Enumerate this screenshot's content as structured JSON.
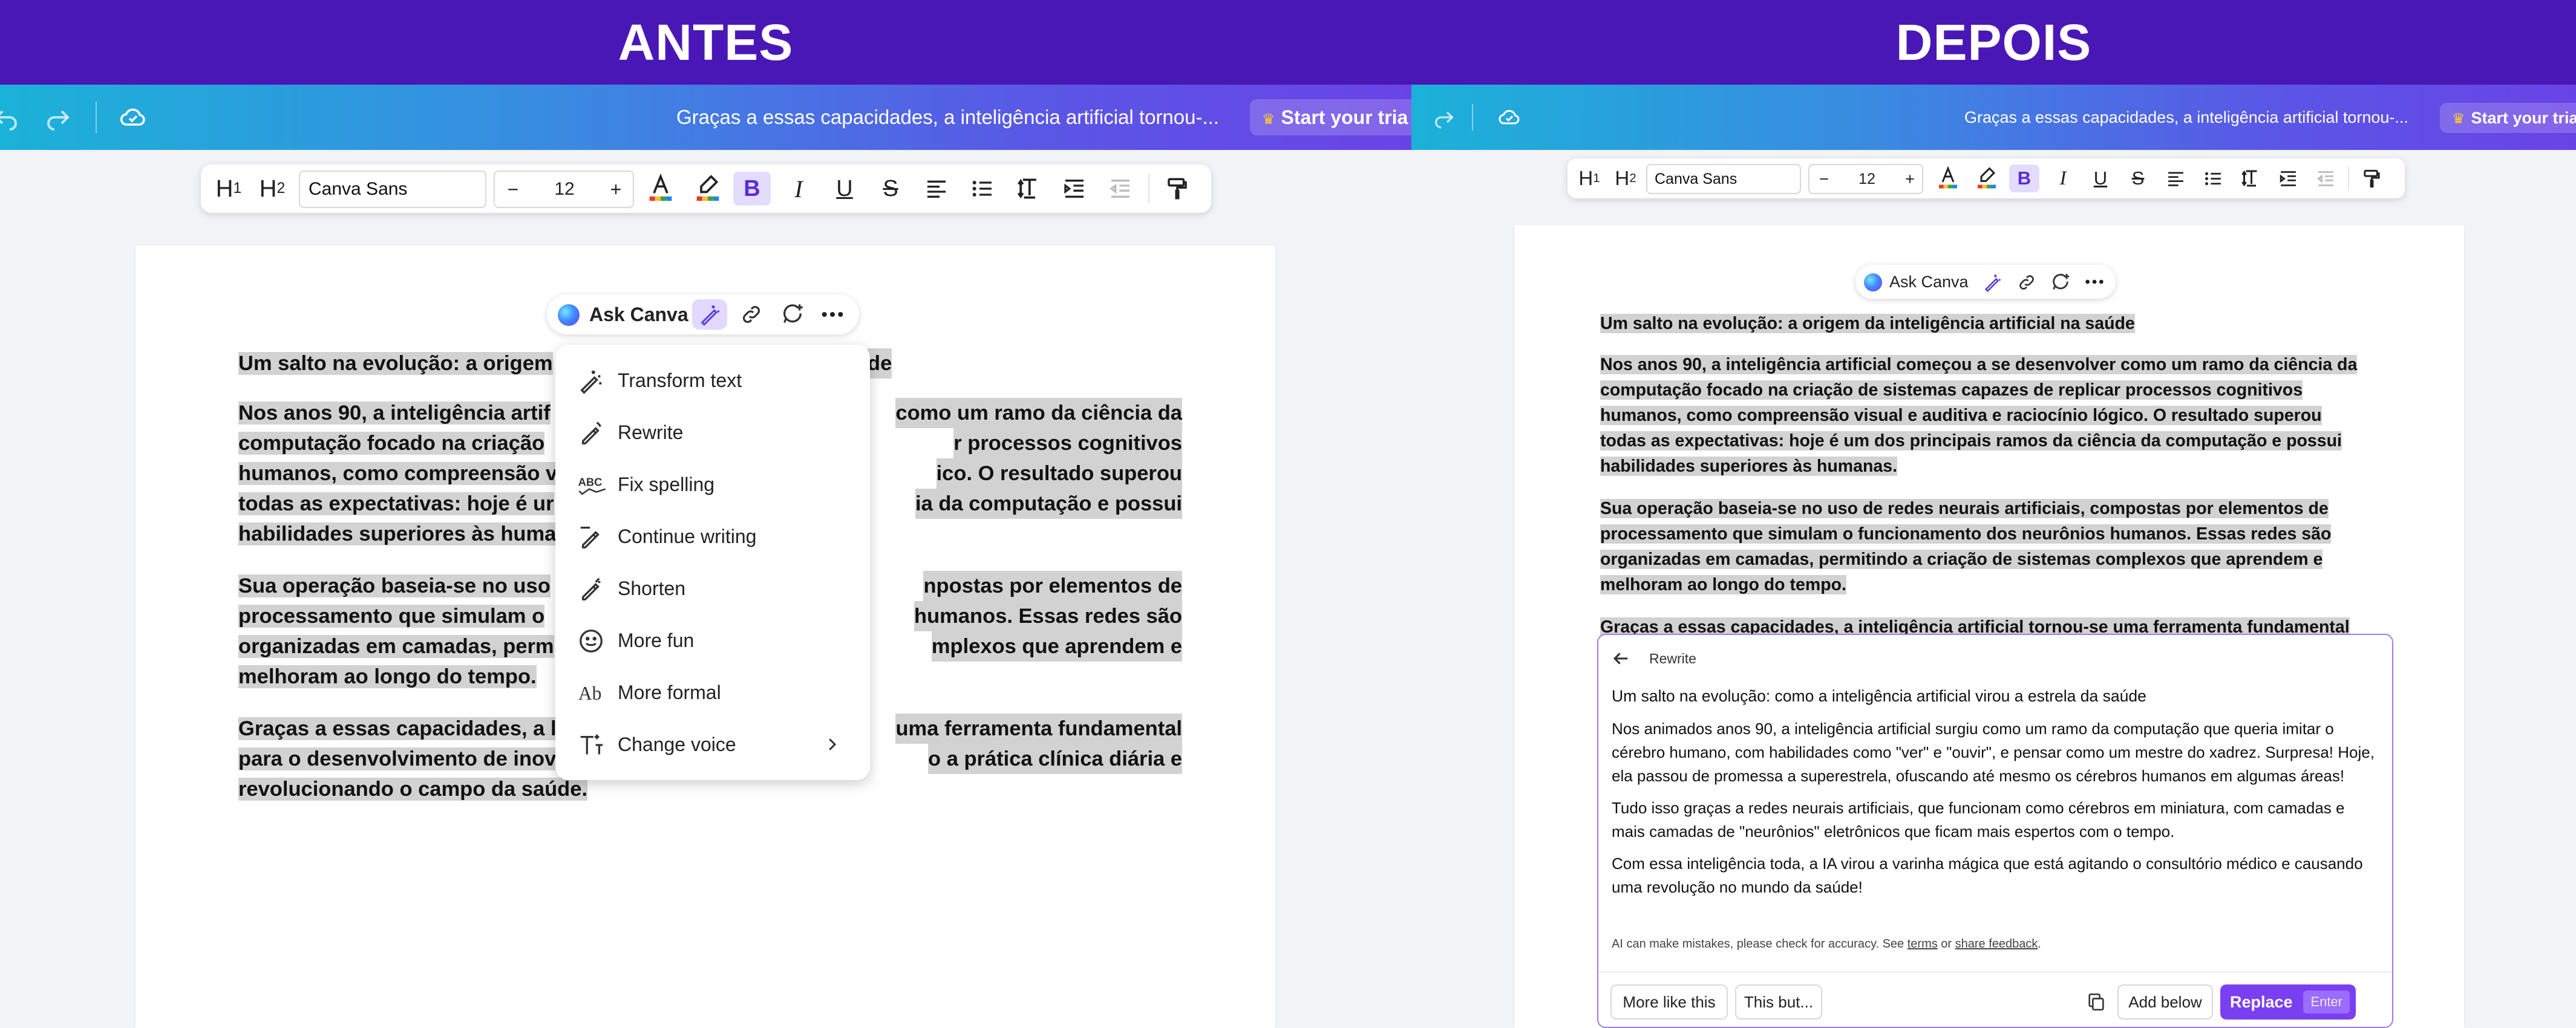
{
  "colors": {
    "banner": "#4a17b7",
    "accent": "#7b3ff2",
    "selection_highlight": "#d2d2d2",
    "spellcheck": "#e0352b"
  },
  "before": {
    "banner_title": "ANTES",
    "topbar": {
      "doc_title": "Graças a essas capacidades, a inteligência artificial tornou-...",
      "trial_label": "Start your tria"
    },
    "toolbar": {
      "h1": "H",
      "h2": "H",
      "font_name": "Canva Sans",
      "font_size": "12",
      "minus": "−",
      "plus": "+"
    },
    "ask_bar": {
      "label": "Ask Canva"
    },
    "document": {
      "heading": "Um salto na evolução: a origem",
      "heading_tail": "de",
      "para1": [
        {
          "l": "Nos anos 90, a inteligência artif",
          "r": "como um ramo da ciência da"
        },
        {
          "l": "computação focado na criação",
          "r": "r processos cognitivos"
        },
        {
          "l": "humanos, como compreensão v",
          "r": "ico. O resultado superou"
        },
        {
          "l": "todas as expectativas: hoje é ur",
          "r": "ia da computação e possui"
        },
        {
          "l": "habilidades superiores às huma",
          "r": ""
        }
      ],
      "para2": [
        {
          "l": "Sua operação baseia-se no uso",
          "r": "npostas por elementos de"
        },
        {
          "l": "processamento que simulam o",
          "r": "humanos. Essas redes são"
        },
        {
          "l": "organizadas em camadas, perm",
          "r": "mplexos que aprendem e"
        },
        {
          "l": "melhoram ao longo do tempo.",
          "r": ""
        }
      ],
      "para3": [
        {
          "l": "Graças a essas capacidades, a li",
          "r": "uma ferramenta fundamental"
        },
        {
          "l": "para o desenvolvimento de inov",
          "r": "o a prática clínica diária e"
        },
        {
          "l": "revolucionando o campo da saúde.",
          "r": ""
        }
      ]
    },
    "menu": {
      "items": [
        {
          "label": "Transform text",
          "icon": "magic-wand-icon"
        },
        {
          "label": "Rewrite",
          "icon": "rewrite-pen-icon"
        },
        {
          "label": "Fix spelling",
          "icon": "abc-check-icon"
        },
        {
          "label": "Continue writing",
          "icon": "continue-pen-icon"
        },
        {
          "label": "Shorten",
          "icon": "shorten-pen-icon"
        },
        {
          "label": "More fun",
          "icon": "smile-icon"
        },
        {
          "label": "More formal",
          "icon": "formal-ab-icon"
        },
        {
          "label": "Change voice",
          "icon": "voice-text-icon"
        }
      ]
    }
  },
  "after": {
    "banner_title": "DEPOIS",
    "topbar": {
      "doc_title": "Graças a essas capacidades, a inteligência artificial tornou-...",
      "trial_label": "Start your tria"
    },
    "toolbar": {
      "h1": "H",
      "h2": "H",
      "font_name": "Canva Sans",
      "font_size": "12",
      "minus": "−",
      "plus": "+"
    },
    "ask_bar": {
      "label": "Ask Canva"
    },
    "document": {
      "heading": "Um salto na evolução: a origem da inteligência artificial na saúde",
      "para1": [
        "Nos anos 90, a inteligência artificial começou a se desenvolver como um ramo da ciência da",
        "computação focado na criação de sistemas capazes de replicar processos cognitivos",
        "humanos, como compreensão visual e auditiva e raciocínio lógico. O resultado superou",
        "todas as expectativas: hoje é um dos principais ramos da ciência da computação e possui",
        "habilidades superiores às humanas."
      ],
      "para2": [
        "Sua operação baseia-se no uso de redes neurais artificiais, compostas por elementos de",
        "processamento que simulam o funcionamento dos neurônios humanos. Essas redes são",
        "organizadas em camadas, permitindo a criação de sistemas complexos que aprendem e",
        "melhoram ao longo do tempo."
      ],
      "para3_first_line": "Graças a essas capacidades, a inteligência artificial tornou-se uma ferramenta fundamental"
    },
    "rewrite_panel": {
      "header": "Rewrite",
      "title": "Um salto na evolução: como a inteligência artificial virou a estrela da saúde",
      "para1": "Nos animados anos 90, a inteligência artificial surgiu como um ramo da computação que queria imitar o cérebro humano, com habilidades como \"ver\" e \"ouvir\", e pensar como um mestre do xadrez. Surpresa! Hoje, ela passou de promessa a superestrela, ofuscando até mesmo os cérebros humanos em algumas áreas!",
      "para2": "Tudo isso graças a redes neurais artificiais, que funcionam como cérebros em miniatura, com camadas e mais camadas de \"neurônios\" eletrônicos que ficam mais espertos com o tempo.",
      "para3": "Com essa inteligência toda, a IA virou a varinha mágica que está agitando o consultório médico e causando uma revolução no mundo da saúde!",
      "disclaimer_prefix": "AI can make mistakes, please check for accuracy. See ",
      "disclaimer_terms": "terms",
      "disclaimer_or": " or ",
      "disclaimer_feedback": "share feedback",
      "disclaimer_suffix": ".",
      "btn_more_like": "More like this",
      "btn_this_but": "This but...",
      "btn_add_below": "Add below",
      "btn_replace": "Replace",
      "btn_replace_key": "Enter"
    }
  }
}
